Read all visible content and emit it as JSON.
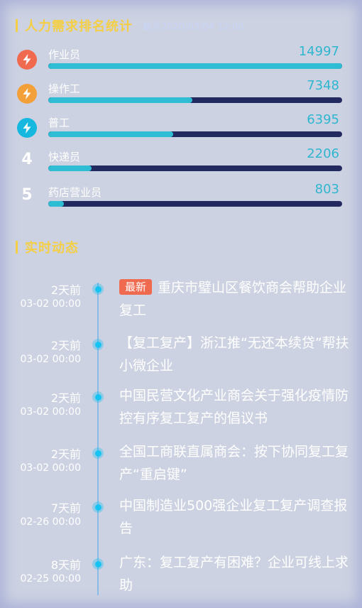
{
  "ranking": {
    "title": "人力需求排名统计",
    "subtitle": "截至2020/03/04 12:00",
    "items": [
      {
        "rank": 1,
        "label": "作业员",
        "value": 14997,
        "value_text": "14997",
        "fill": 1.0,
        "icon": "lightning-icon",
        "badge_color": "#f06a4f"
      },
      {
        "rank": 2,
        "label": "操作工",
        "value": 7348,
        "value_text": "7348",
        "fill": 0.49,
        "icon": "lightning-icon",
        "badge_color": "#f4a03a"
      },
      {
        "rank": 3,
        "label": "普工",
        "value": 6395,
        "value_text": "6395",
        "fill": 0.426,
        "icon": "lightning-icon",
        "badge_color": "#17b8e0"
      },
      {
        "rank": 4,
        "rank_text": "4",
        "label": "快递员",
        "value": 2206,
        "value_text": "2206",
        "fill": 0.147
      },
      {
        "rank": 5,
        "rank_text": "5",
        "label": "药店营业员",
        "value": 803,
        "value_text": "803",
        "fill": 0.054
      }
    ]
  },
  "news": {
    "title": "实时动态",
    "badge_label": "最新",
    "items": [
      {
        "relative": "2天前",
        "date": "03-02 00:00",
        "text": "重庆市璧山区餐饮商会帮助企业复工",
        "is_new": true
      },
      {
        "relative": "2天前",
        "date": "03-02 00:00",
        "text": "【复工复产】浙江推“无还本续贷”帮扶小微企业",
        "is_new": false
      },
      {
        "relative": "2天前",
        "date": "03-02 00:00",
        "text": "中国民营文化产业商会关于强化疫情防控有序复工复产的倡议书",
        "is_new": false
      },
      {
        "relative": "2天前",
        "date": "03-02 00:00",
        "text": "全国工商联直属商会：按下协同复工复产“重启键”",
        "is_new": false
      },
      {
        "relative": "7天前",
        "date": "02-26 00:00",
        "text": "中国制造业500强企业复工复产调查报告",
        "is_new": false
      },
      {
        "relative": "8天前",
        "date": "02-25 00:00",
        "text": "广东：复工复产有困难？企业可线上求助",
        "is_new": false
      }
    ]
  },
  "colors": {
    "accent_yellow": "#f4cf45",
    "value_cyan": "#2fb6cf",
    "track_navy": "#222a60",
    "fill_cyan": "#2ebdd2",
    "badge_red": "#f06a4f"
  }
}
